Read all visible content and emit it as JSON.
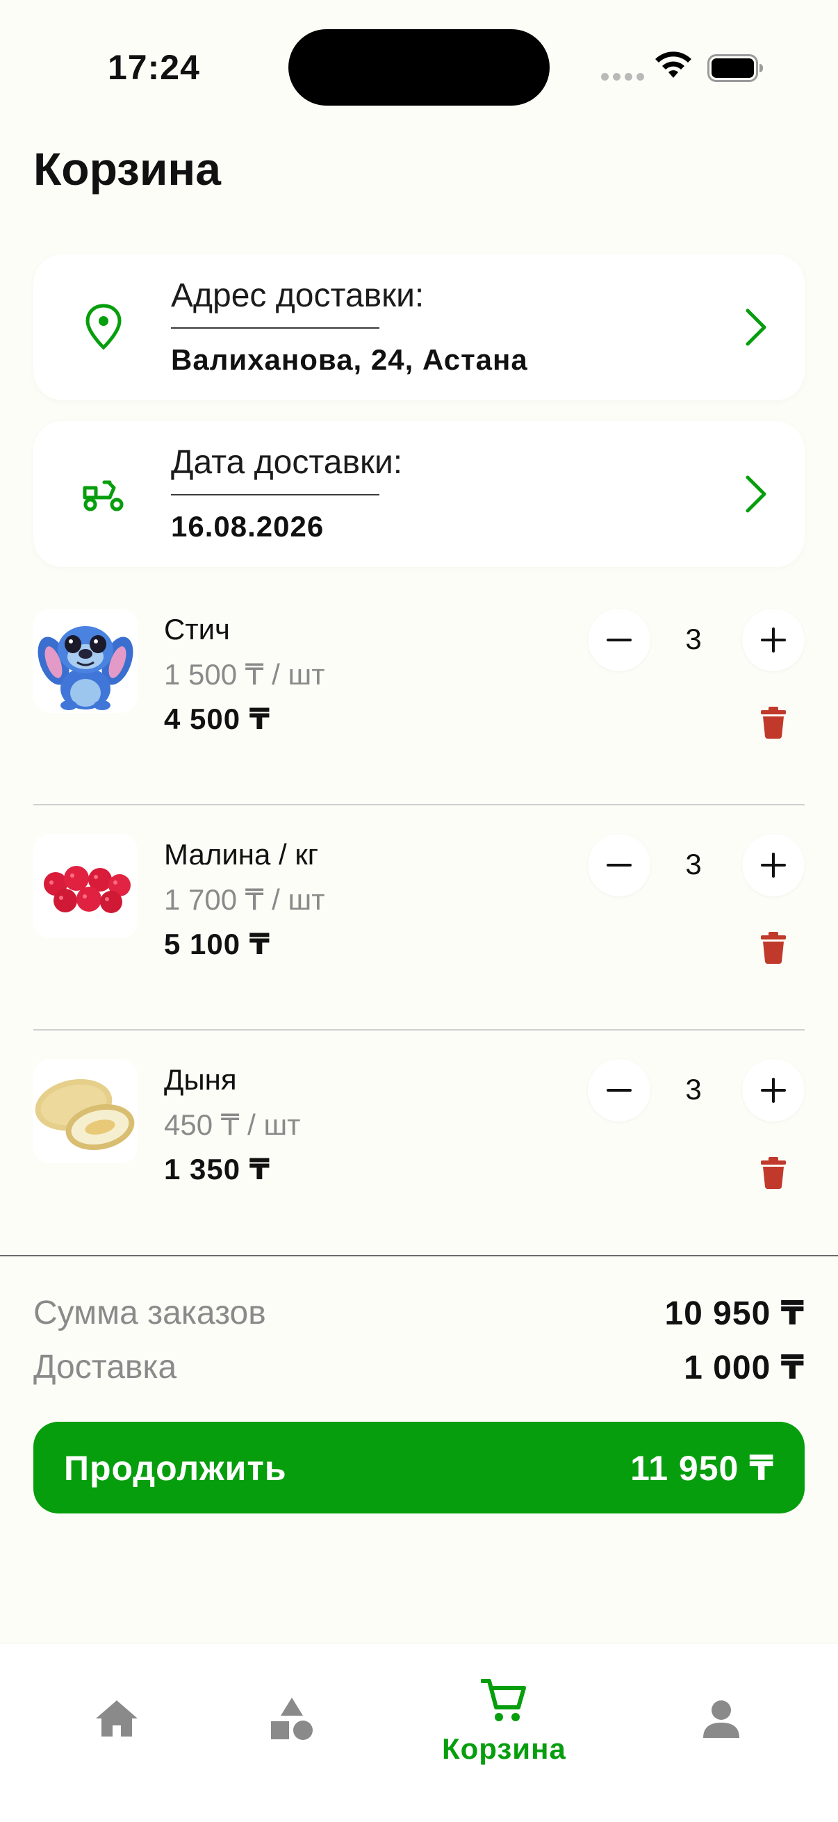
{
  "status_bar": {
    "time": "17:24"
  },
  "page": {
    "title": "Корзина"
  },
  "delivery_address": {
    "label": "Адрес доставки:",
    "value": "Валиханова, 24, Астана",
    "icon": "location-pin-icon"
  },
  "delivery_date": {
    "label": "Дата доставки:",
    "value": "16.08.2026",
    "icon": "scooter-icon"
  },
  "cart": {
    "items": [
      {
        "name": "Стич",
        "unit_price": "1 500 ₸ / шт",
        "total": "4 500 ₸",
        "quantity": "3"
      },
      {
        "name": "Малина / кг",
        "unit_price": "1 700 ₸ / шт",
        "total": "5 100 ₸",
        "quantity": "3"
      },
      {
        "name": "Дыня",
        "unit_price": "450 ₸ / шт",
        "total": "1 350 ₸",
        "quantity": "3"
      }
    ]
  },
  "summary": {
    "orders_label": "Сумма заказов",
    "orders_value": "10 950 ₸",
    "delivery_label": "Доставка",
    "delivery_value": "1 000 ₸"
  },
  "continue_button": {
    "label": "Продолжить",
    "total": "11 950 ₸"
  },
  "bottom_nav": {
    "items": [
      {
        "icon": "home-icon",
        "active": false
      },
      {
        "icon": "categories-icon",
        "active": false
      },
      {
        "icon": "cart-icon",
        "label": "Корзина",
        "active": true
      },
      {
        "icon": "profile-icon",
        "active": false
      }
    ]
  },
  "colors": {
    "accent": "#069e0d",
    "danger": "#c0392b",
    "background": "#fdfdf7",
    "muted": "#8a8a8a",
    "inactive_icon": "#8a8a8a"
  }
}
